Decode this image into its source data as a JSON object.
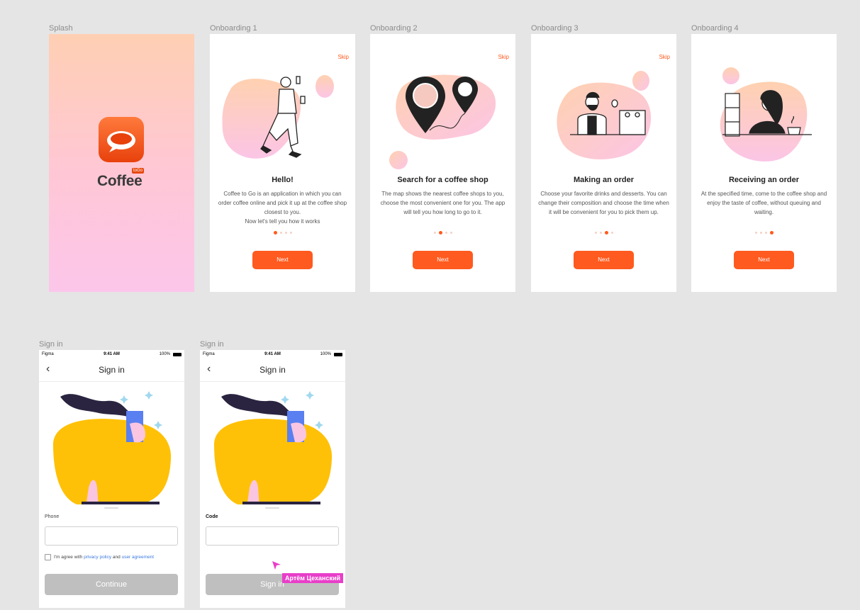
{
  "frames": {
    "splash_label": "Splash",
    "onboarding1_label": "Onboarding 1",
    "onboarding2_label": "Onboarding 2",
    "onboarding3_label": "Onboarding 3",
    "onboarding4_label": "Onboarding 4",
    "signin1_label": "Sign in",
    "signin2_label": "Sign in"
  },
  "splash": {
    "logo_word": "Coffee",
    "logo_badge": "toGo"
  },
  "onboarding": [
    {
      "skip": "Skip",
      "title": "Hello!",
      "text": "Coffee to Go is an application in which you can order coffee online and pick it up at the coffee shop closest to you.\nNow let's tell you how it works",
      "next": "Next",
      "active_dot": 0
    },
    {
      "skip": "Skip",
      "title": "Search for a coffee shop",
      "text": "The map shows the nearest coffee shops to you, choose the most convenient one for you. The app will tell you how long to go to it.",
      "next": "Next",
      "active_dot": 1
    },
    {
      "skip": "Skip",
      "title": "Making an order",
      "text": "Choose your favorite drinks and desserts. You can change their composition and choose the time when it will be convenient for you to pick them up.",
      "next": "Next",
      "active_dot": 2
    },
    {
      "skip": "",
      "title": "Receiving an order",
      "text": "At the specified time, come to the coffee shop and enjoy the taste of coffee, without queuing and waiting.",
      "next": "Next",
      "active_dot": 3
    }
  ],
  "status_bar": {
    "carrier": "Figma",
    "time": "9:41 AM",
    "battery": "100%"
  },
  "signin_phone": {
    "nav_title": "Sign in",
    "field_label": "Phone",
    "agree_prefix": "I'm agree with",
    "privacy_link": "privacy policy",
    "agree_and": "and",
    "agreement_link": "user agreement",
    "button": "Continue"
  },
  "signin_code": {
    "nav_title": "Sign in",
    "field_label": "Code",
    "button": "Sign in"
  },
  "cursor_tag": "Артём Цеханский",
  "colors": {
    "accent": "#ff5a1f",
    "disabled": "#bfbfbf",
    "link": "#3c7be0",
    "cursor": "#e83ec9"
  }
}
